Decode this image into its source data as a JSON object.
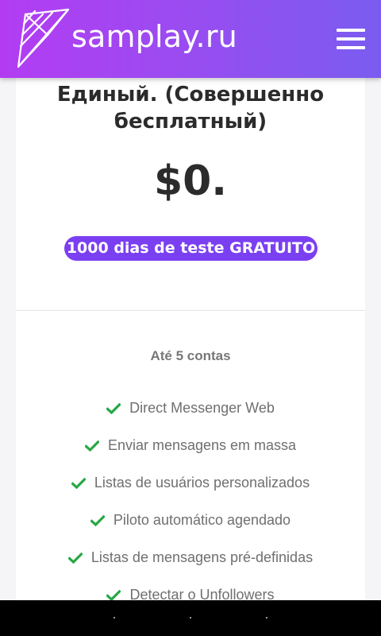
{
  "header": {
    "brand": "samplay.ru",
    "logo_icon": "paper-plane-icon",
    "menu_icon": "hamburger-menu-icon",
    "gradient_colors": [
      "#b33cf2",
      "#7a5cf0"
    ]
  },
  "plan": {
    "title": "Единый. (Совершенно бесплатный)",
    "price": "$0.",
    "trial_badge": "1000 dias de teste GRATUITO",
    "badge_color": "#7b3ff2",
    "accounts": "Até 5 contas",
    "check_icon": "check-icon",
    "check_color": "#27a844",
    "features": [
      "Direct Messenger Web",
      "Enviar mensagens em massa",
      "Listas de usuários personalizados",
      "Piloto automático agendado",
      "Listas de mensagens pré-definidas",
      "Detectar o Unfollowers"
    ]
  },
  "system_nav": {
    "buttons": [
      "back-button",
      "home-button",
      "recents-button"
    ]
  }
}
